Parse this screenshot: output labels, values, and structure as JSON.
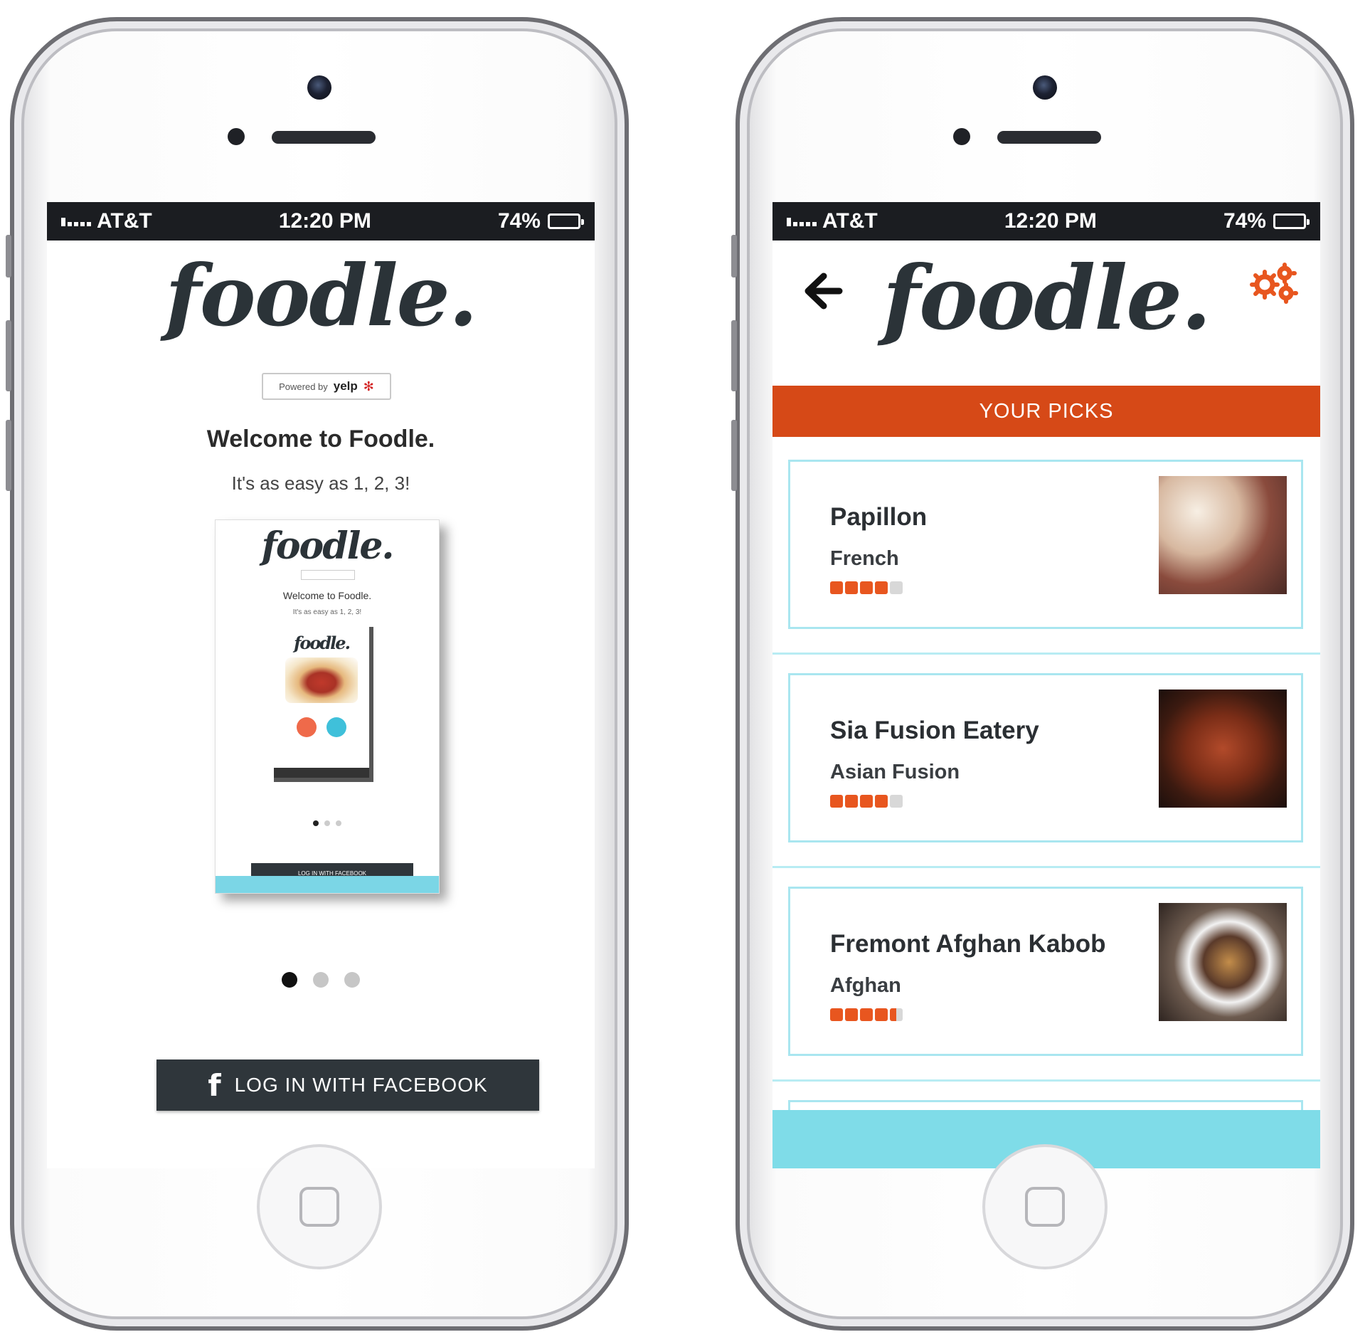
{
  "status_bar": {
    "carrier": "AT&T",
    "time": "12:20 PM",
    "battery": "74%"
  },
  "brand": {
    "logo_text": "foodle.",
    "powered_by": "Powered by",
    "yelp": "yelp",
    "accent_color": "#d64917",
    "cyan_color": "#7fdce8",
    "dark_color": "#2f363b"
  },
  "welcome_screen": {
    "heading": "Welcome to Foodle.",
    "tagline": "It's as easy as 1, 2, 3!",
    "preview": {
      "logo_text": "foodle.",
      "heading": "Welcome to Foodle.",
      "tagline": "It's as easy as 1, 2, 3!",
      "inner_logo": "foodle.",
      "button": "LOG IN WITH FACEBOOK"
    },
    "pagination": {
      "total": 3,
      "active": 1
    },
    "login_button": "LOG IN WITH FACEBOOK",
    "facebook_icon": "f"
  },
  "picks_screen": {
    "header_icons": {
      "back": "back-arrow-icon",
      "settings": "gears-icon"
    },
    "section_title": "YOUR PICKS",
    "restaurants": [
      {
        "name": "Papillon",
        "cuisine": "French",
        "rating": 4
      },
      {
        "name": "Sia Fusion Eatery",
        "cuisine": "Asian Fusion",
        "rating": 4
      },
      {
        "name": "Fremont Afghan Kabob",
        "cuisine": "Afghan",
        "rating": 4.5
      }
    ]
  }
}
